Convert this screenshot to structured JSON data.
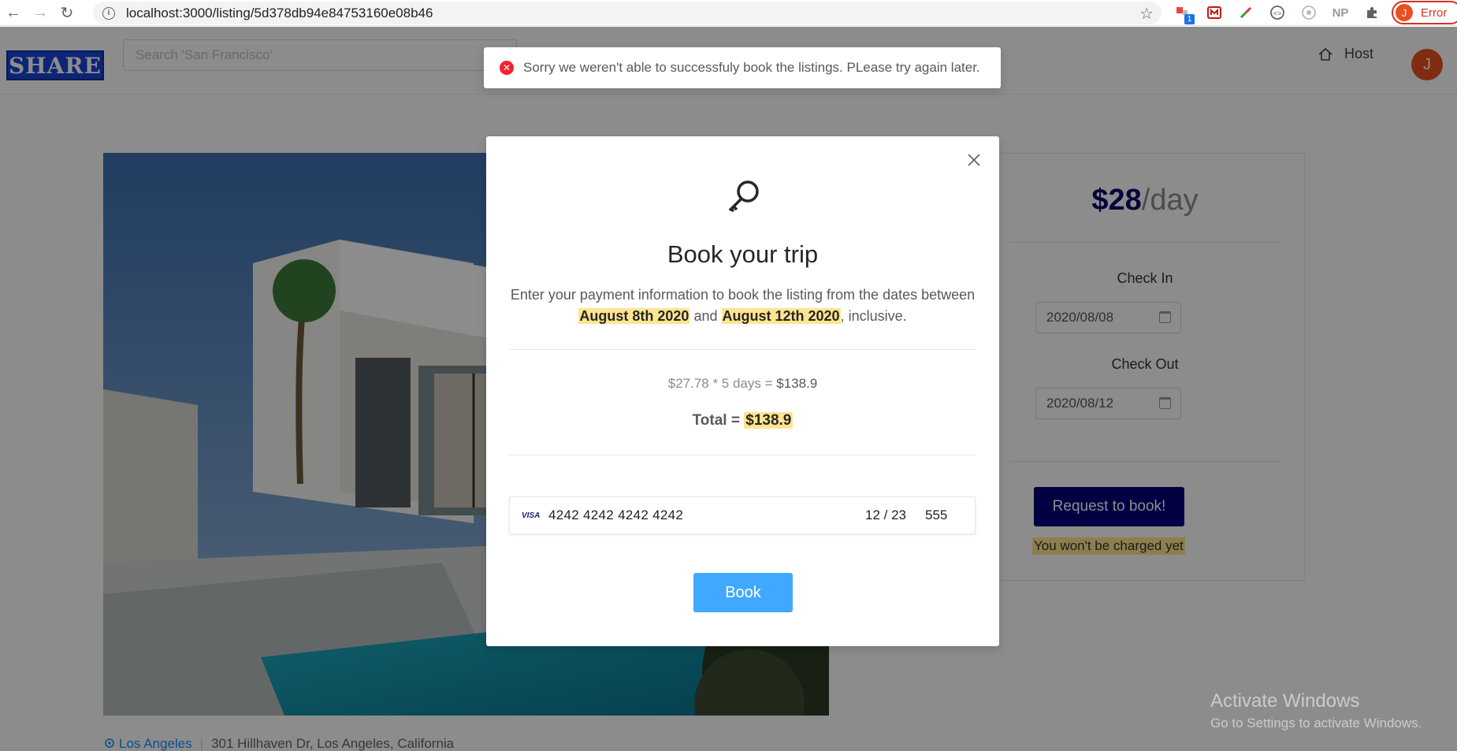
{
  "browser": {
    "url": "localhost:3000/listing/5d378db94e84753160e08b46",
    "ext_badge": "1",
    "ext_np": "NP",
    "profile_initial": "J",
    "profile_label": "Error"
  },
  "header": {
    "logo_text": "SHARE",
    "search_placeholder": "Search 'San Francisco'",
    "host_label": "Host",
    "avatar_initial": "J"
  },
  "listing": {
    "price_amount": "$28",
    "price_unit": "/day",
    "check_in_label": "Check In",
    "check_in_value": "2020/08/08",
    "check_out_label": "Check Out",
    "check_out_value": "2020/08/12",
    "request_button": "Request to book!",
    "hint": "You won't be charged yet",
    "location_city": "Los Angeles",
    "location_address": "301 Hillhaven Dr, Los Angeles, California"
  },
  "modal": {
    "title": "Book your trip",
    "desc_prefix": "Enter your payment information to book the listing from the dates between",
    "date_start": "August 8th 2020",
    "desc_and": "and",
    "date_end": "August 12th 2020",
    "desc_suffix": ", inclusive.",
    "calc": "$27.78 * 5 days = ",
    "calc_total": "$138.9",
    "total_label": "Total = ",
    "total_value": "$138.9",
    "card_brand": "VISA",
    "card_number": "4242 4242 4242 4242",
    "card_expiry": "12 / 23",
    "card_cvc": "555",
    "book_button": "Book"
  },
  "toast": {
    "message": "Sorry we weren't able to successfuly book the listings. PLease try again later."
  },
  "watermark": {
    "title": "Activate Windows",
    "subtitle": "Go to Settings to activate Windows."
  },
  "colors": {
    "brand_navy": "#05007a",
    "primary_blue": "#40a9ff",
    "highlight": "#ffe58f",
    "error_red": "#f5222d"
  }
}
